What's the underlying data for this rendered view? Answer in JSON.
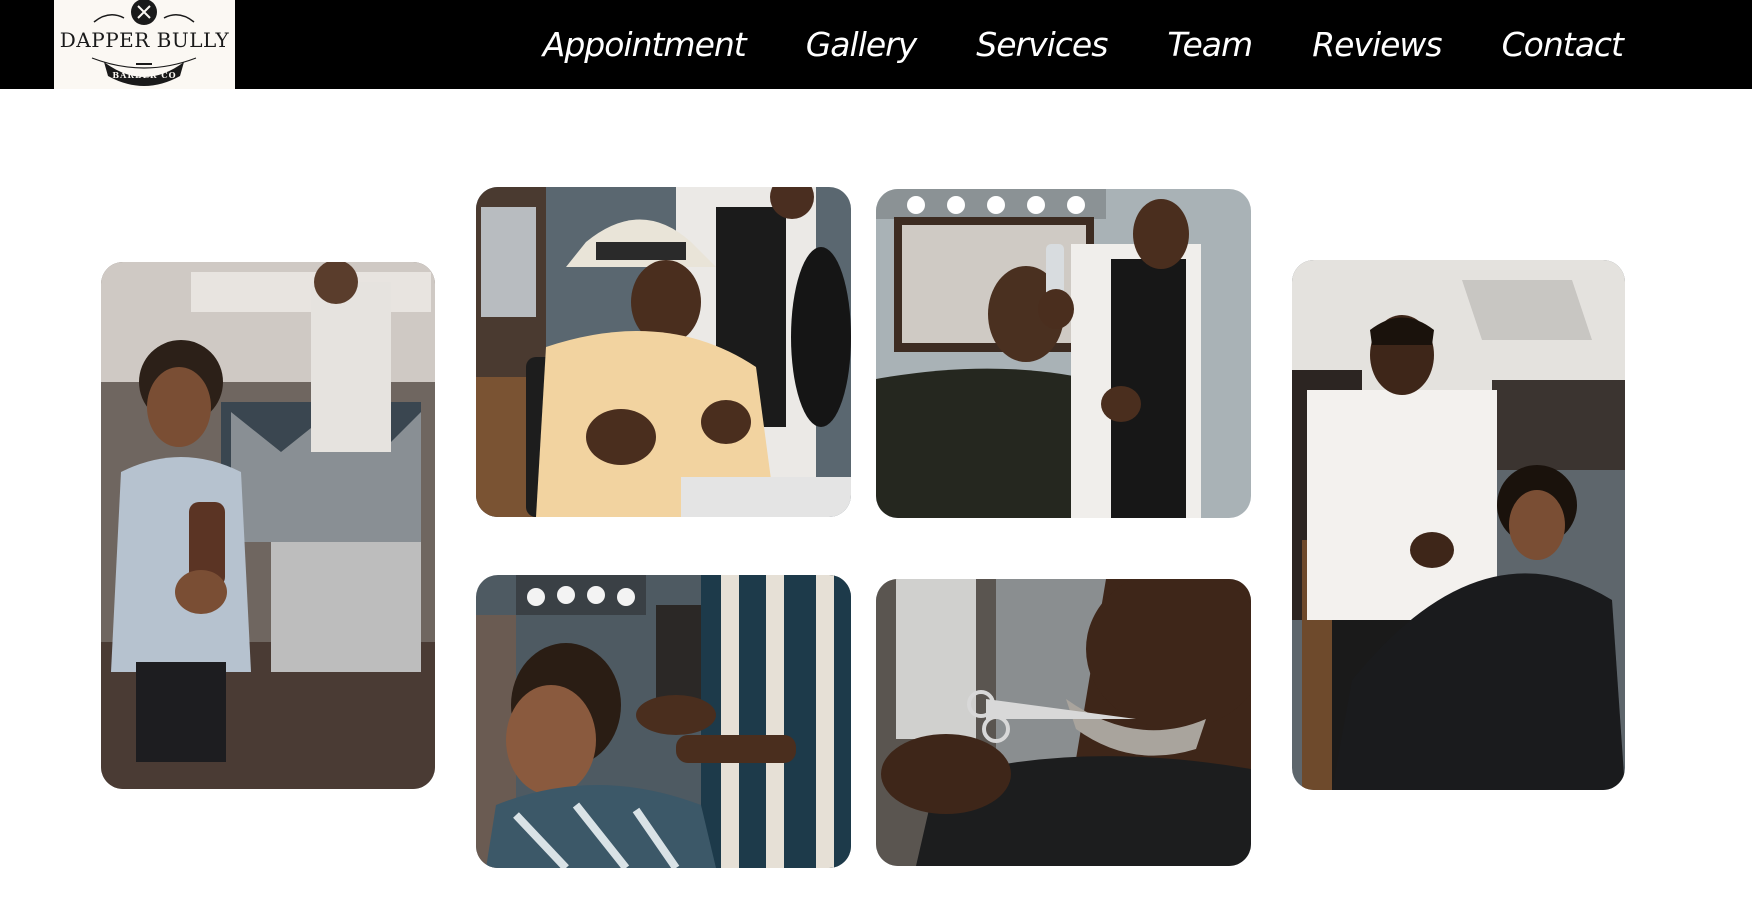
{
  "logo": {
    "brand": "DAPPER BULLY",
    "sub": "BARBER CO"
  },
  "nav": {
    "items": [
      "Appointment",
      "Gallery",
      "Services",
      "Team",
      "Reviews",
      "Contact"
    ]
  },
  "gallery": {
    "photos": [
      "boy-with-hairbrush-photo",
      "man-in-hat-with-barber-photo",
      "barber-spraying-client-photo",
      "barber-with-boy-client-photo",
      "young-man-haircut-photo",
      "beard-trim-scissors-photo"
    ]
  }
}
